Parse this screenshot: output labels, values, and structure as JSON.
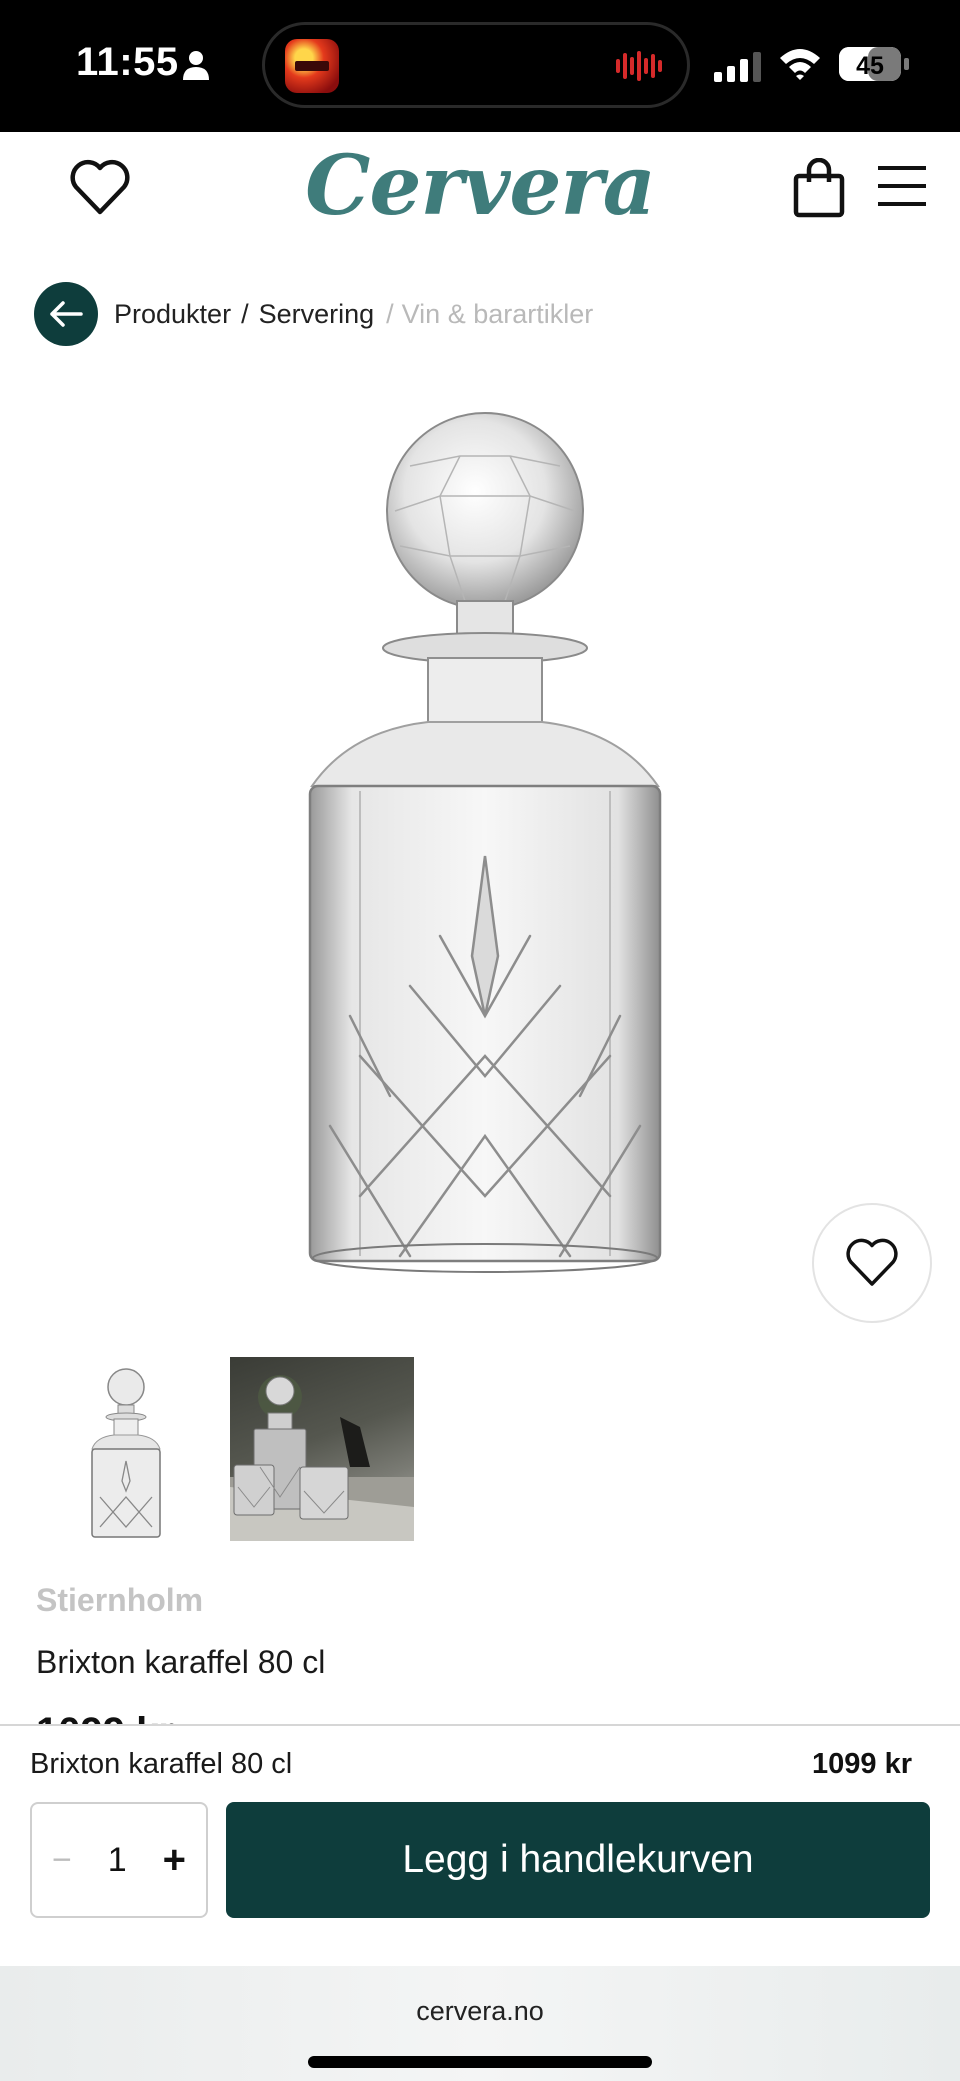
{
  "status_bar": {
    "time": "11:55",
    "battery": "45"
  },
  "header": {
    "brand": "Cervera"
  },
  "breadcrumb": {
    "items": [
      "Produkter",
      "Servering",
      "Vin & barartikler"
    ],
    "separator": "/"
  },
  "product": {
    "brand": "Stiernholm",
    "title": "Brixton karaffel 80 cl",
    "price_partial": "1099 kr"
  },
  "sticky_bar": {
    "title": "Brixton karaffel 80 cl",
    "price": "1099 kr",
    "quantity_minus": "−",
    "quantity": "1",
    "quantity_plus": "+",
    "add_to_cart_label": "Legg i handlekurven"
  },
  "browser": {
    "url": "cervera.no"
  },
  "colors": {
    "accent": "#0e3d3c",
    "logo": "#3f7c7b",
    "muted": "#b9b9b9"
  },
  "icons": [
    "person-icon",
    "signal-icon",
    "wifi-icon",
    "battery-icon",
    "heart-icon",
    "bag-icon",
    "menu-icon",
    "arrow-left-icon"
  ]
}
